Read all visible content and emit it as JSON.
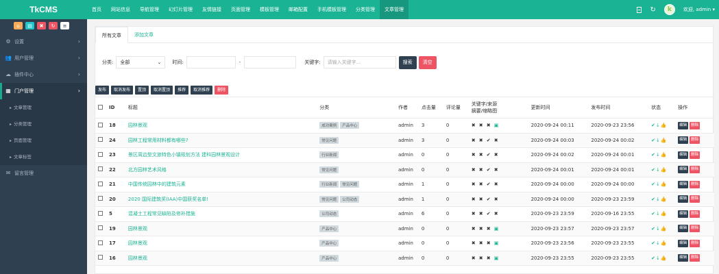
{
  "app": {
    "logo": "TkCMS"
  },
  "nav": [
    "首页",
    "网站信息",
    "导航管理",
    "幻灯片管理",
    "友情链接",
    "页面管理",
    "模板管理",
    "邮箱配置",
    "手机模板管理",
    "分类管理",
    "文章管理"
  ],
  "nav_active": "文章管理",
  "user": {
    "greeting": "欢迎, admin",
    "avatar_letter": "k"
  },
  "quick_buttons": [
    {
      "icon": "home-icon",
      "glyph": "⌂",
      "color": "#f8ac59"
    },
    {
      "icon": "file-icon",
      "glyph": "▤",
      "color": "#23c6c8"
    },
    {
      "icon": "trash-icon",
      "glyph": "✖",
      "color": "#ed5565"
    },
    {
      "icon": "refresh-icon",
      "glyph": "↻",
      "color": "#ed5565"
    },
    {
      "icon": "list-icon",
      "glyph": "≡",
      "color": "#ffffff"
    }
  ],
  "sidebar": {
    "items": [
      {
        "label": "设置",
        "icon": "gears-icon",
        "glyph": "⚙"
      },
      {
        "label": "用户管理",
        "icon": "users-icon",
        "glyph": "👥"
      },
      {
        "label": "插件中心",
        "icon": "cloud-icon",
        "glyph": "☁"
      },
      {
        "label": "门户管理",
        "icon": "grid-icon",
        "glyph": "▦"
      }
    ],
    "sub_items": [
      "文章管理",
      "分类管理",
      "页面管理",
      "文章标签"
    ],
    "last_item": {
      "label": "留言管理",
      "icon": "envelope-icon",
      "glyph": "✉"
    }
  },
  "tabs": [
    "所有文章",
    "添加文章"
  ],
  "filter": {
    "category_label": "分类:",
    "category_value": "全部",
    "time_label": "时间:",
    "time_separator": "-",
    "keyword_label": "关键字:",
    "keyword_placeholder": "请输入关键字...",
    "search_button": "搜索",
    "clear_button": "清空"
  },
  "batch_actions": [
    "发布",
    "取消发布",
    "置顶",
    "取消置顶",
    "推荐",
    "取消推荐",
    "删除"
  ],
  "table": {
    "headers": {
      "id": "ID",
      "title": "标题",
      "category": "分类",
      "author": "作者",
      "clicks": "点击量",
      "comments": "评论量",
      "flags_line1": "关键字/来源",
      "flags_line2": "摘要/缩略图",
      "updated": "更新时间",
      "created": "发布时间",
      "status": "状态",
      "ops": "操作"
    },
    "edit_label": "编辑",
    "delete_label": "删除",
    "rows": [
      {
        "id": "18",
        "title": "园林景观",
        "cats": [
          "成功案例",
          "产品中心"
        ],
        "author": "admin",
        "clicks": "3",
        "comments": "0",
        "flags": [
          "x",
          "x",
          "x",
          "img"
        ],
        "updated": "2020-09-24 00:11",
        "created": "2020-09-23 23:56"
      },
      {
        "id": "24",
        "title": "园林工程常用材料都有哪些?",
        "cats": [
          "常见问题"
        ],
        "author": "admin",
        "clicks": "3",
        "comments": "0",
        "flags": [
          "x",
          "x",
          "ok",
          "x"
        ],
        "updated": "2020-09-24 00:03",
        "created": "2020-09-24 00:02"
      },
      {
        "id": "23",
        "title": "景区周边型文旅特色小镇规划方法 建科园林景观设计",
        "cats": [
          "行业新闻"
        ],
        "author": "admin",
        "clicks": "0",
        "comments": "0",
        "flags": [
          "x",
          "x",
          "ok",
          "x"
        ],
        "updated": "2020-09-24 00:02",
        "created": "2020-09-24 00:01"
      },
      {
        "id": "22",
        "title": "北方园林艺术风格",
        "cats": [
          "常见问题"
        ],
        "author": "admin",
        "clicks": "0",
        "comments": "0",
        "flags": [
          "x",
          "x",
          "ok",
          "x"
        ],
        "updated": "2020-09-24 00:01",
        "created": "2020-09-24 00:01"
      },
      {
        "id": "21",
        "title": "中国传统园林中的建筑元素",
        "cats": [
          "行业新闻",
          "常见问题"
        ],
        "author": "admin",
        "clicks": "1",
        "comments": "0",
        "flags": [
          "x",
          "x",
          "ok",
          "x"
        ],
        "updated": "2020-09-24 00:00",
        "created": "2020-09-24 00:00"
      },
      {
        "id": "20",
        "title": "2020 国际建筑奖(IAA)中国获奖名单!",
        "cats": [
          "常见问题",
          "公司动态"
        ],
        "author": "admin",
        "clicks": "1",
        "comments": "0",
        "flags": [
          "x",
          "x",
          "ok",
          "x"
        ],
        "updated": "2020-09-24 00:00",
        "created": "2020-09-23 23:59"
      },
      {
        "id": "5",
        "title": "混凝土工程常见缺陷及修补措施",
        "cats": [
          "公司动态"
        ],
        "author": "admin",
        "clicks": "6",
        "comments": "0",
        "flags": [
          "x",
          "x",
          "ok",
          "x"
        ],
        "updated": "2020-09-23 23:59",
        "created": "2020-09-16 23:55"
      },
      {
        "id": "19",
        "title": "园林景观",
        "cats": [
          "产品中心"
        ],
        "author": "admin",
        "clicks": "0",
        "comments": "0",
        "flags": [
          "x",
          "x",
          "x",
          "img"
        ],
        "updated": "2020-09-23 23:57",
        "created": "2020-09-23 23:57"
      },
      {
        "id": "17",
        "title": "园林景观",
        "cats": [
          "产品中心"
        ],
        "author": "admin",
        "clicks": "0",
        "comments": "0",
        "flags": [
          "x",
          "x",
          "x",
          "img"
        ],
        "updated": "2020-09-23 23:56",
        "created": "2020-09-23 23:55"
      },
      {
        "id": "16",
        "title": "园林景观",
        "cats": [
          "产品中心"
        ],
        "author": "admin",
        "clicks": "0",
        "comments": "0",
        "flags": [
          "x",
          "x",
          "x",
          "img"
        ],
        "updated": "2020-09-23 23:55",
        "created": "2020-09-23 23:55"
      }
    ]
  }
}
